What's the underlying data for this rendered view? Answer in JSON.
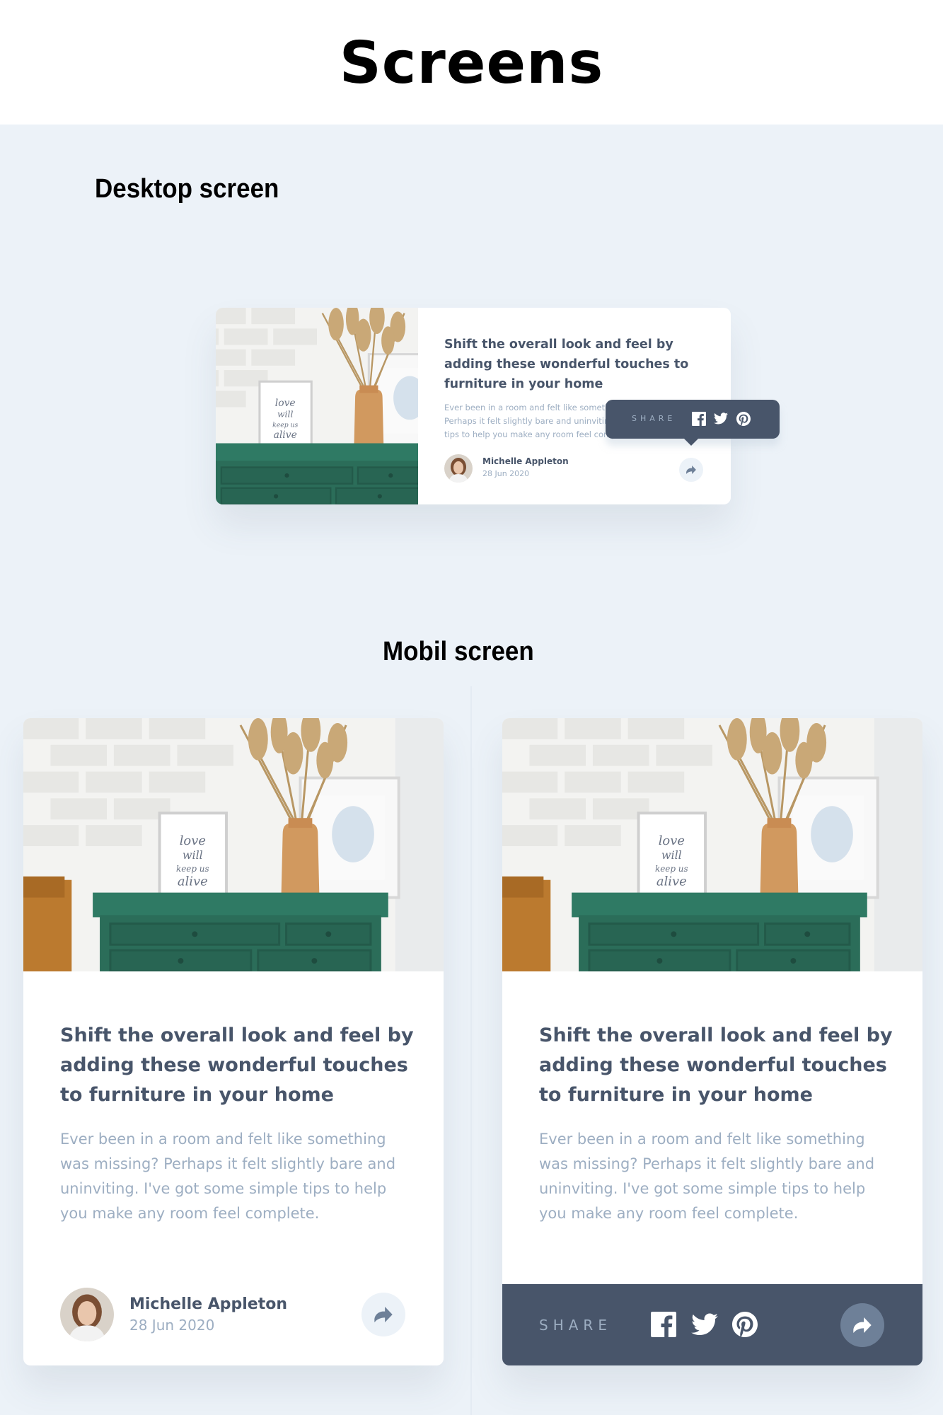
{
  "page_title": "Screens",
  "sections": {
    "desktop": "Desktop screen",
    "mobile": "Mobil screen"
  },
  "article": {
    "headline": "Shift the overall look and feel by adding these wonderful touches to furniture in your home",
    "description": "Ever been in a room and felt like something was missing? Perhaps it felt slightly bare and uninviting. I've got some simple tips to help you make any room feel complete.",
    "desktop_description": "Ever been in a room and felt like something was missing? Perhaps it felt slightly bare and uninviting. I've got some simple tips to help you make any room feel complete.",
    "author": "Michelle Appleton",
    "date": "28 Jun 2020",
    "photo_frame_text": "love will keep us alive"
  },
  "share": {
    "label": "SHARE",
    "icons": [
      "facebook-icon",
      "twitter-icon",
      "pinterest-icon"
    ],
    "button_icon": "share-arrow-icon"
  },
  "colors": {
    "background": "#ecf2f8",
    "dark_blue": "#48556a",
    "grayish_blue": "#9daec2",
    "light_grayish_blue": "#ecf2f8",
    "white": "#ffffff"
  }
}
